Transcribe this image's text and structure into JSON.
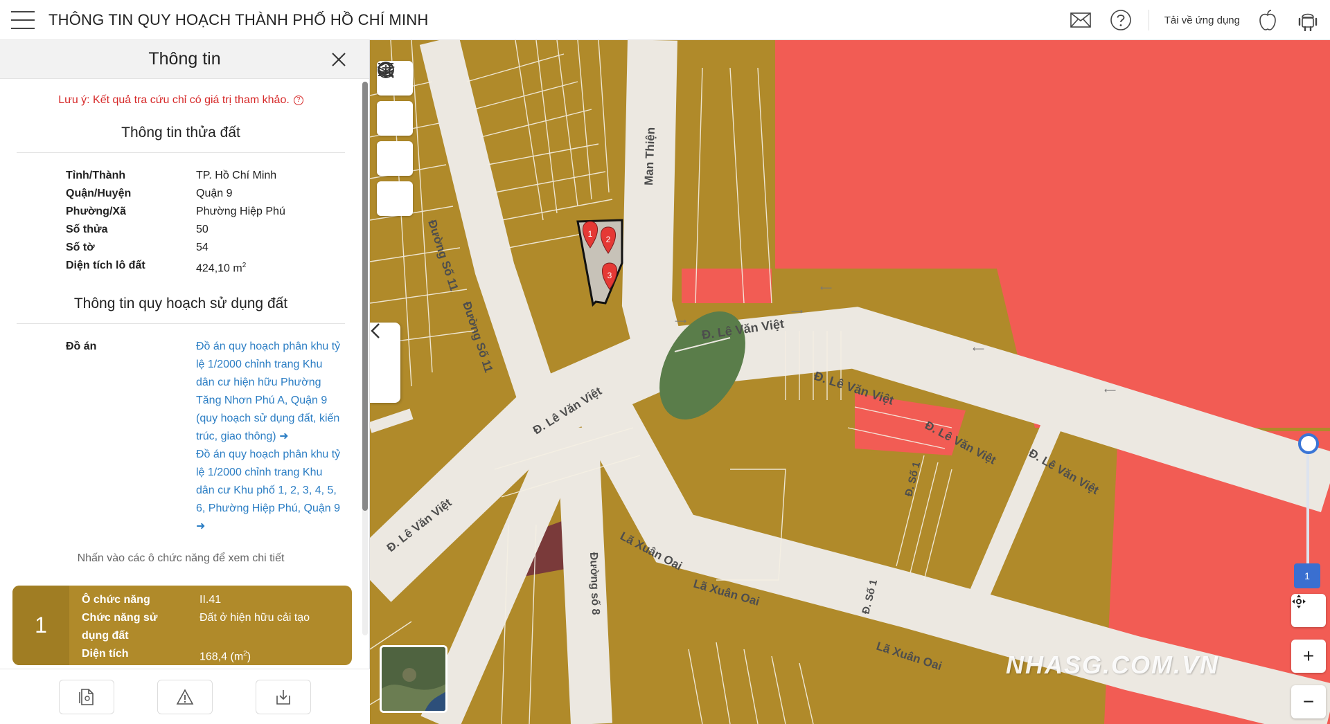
{
  "app": {
    "title": "THÔNG TIN QUY HOẠCH THÀNH PHỐ HỒ CHÍ MINH",
    "download_label": "Tải về ứng dụng",
    "icons": [
      "menu-icon",
      "mail-icon",
      "help-icon",
      "apple-icon",
      "android-icon"
    ]
  },
  "panel": {
    "title": "Thông tin",
    "note": "Lưu ý: Kết quả tra cứu chỉ có giá trị tham khảo.",
    "parcel_section": "Thông tin thửa đất",
    "parcel": [
      {
        "key": "Tỉnh/Thành",
        "value": "TP. Hồ Chí Minh"
      },
      {
        "key": "Quận/Huyện",
        "value": "Quận 9"
      },
      {
        "key": "Phường/Xã",
        "value": "Phường Hiệp Phú"
      },
      {
        "key": "Số thửa",
        "value": "50"
      },
      {
        "key": "Số tờ",
        "value": "54"
      }
    ],
    "area_key": "Diện tích lô đất",
    "area_value": "424,10 m",
    "area_unit_sup": "2",
    "plan_section": "Thông tin quy hoạch sử dụng đất",
    "plan_key": "Đồ án",
    "plans": [
      "Đồ án quy hoạch phân khu tỷ lệ 1/2000 chỉnh trang Khu dân cư hiện hữu Phường Tăng Nhơn Phú A, Quận 9 (quy hoạch sử dụng đất, kiến trúc, giao thông)",
      "Đồ án quy hoạch phân khu tỷ lệ 1/2000 chỉnh trang Khu dân cư Khu phố 1, 2, 3, 4, 5, 6, Phường Hiệp Phú, Quận 9"
    ],
    "hint": "Nhấn vào các ô chức năng để xem chi tiết",
    "zone": {
      "number": "1",
      "cell_key": "Ô chức năng",
      "cell_value": "II.41",
      "func_key": "Chức năng sử dụng đất",
      "func_value": "Đất ở hiện hữu cải tạo",
      "area_key": "Diện tích",
      "area_value": "168,4 (m",
      "area_sup": "2",
      "area_close": ")"
    },
    "footer_icons": [
      "document-icon",
      "warning-icon",
      "download-icon"
    ]
  },
  "map": {
    "roads": {
      "man_thien": "Man Thiện",
      "duong_so_11a": "Đường Số 11",
      "duong_so_11b": "Đường Số 11",
      "le_van_viet": "Đ. Lê Văn Việt",
      "la_xuan_oai": "Lã Xuân Oai",
      "duong_so_8": "Đường số 8",
      "duong_so_1": "Đ. Số 1",
      "d_prefix": "Đ."
    },
    "markers": [
      "1",
      "2",
      "3"
    ],
    "zoom_level_label": "1",
    "watermark": "NHASG.COM.VN",
    "colors": {
      "residential": "#b08a2a",
      "commercial": "#f25c54",
      "green": "#5a7d4a",
      "road": "#ece8e1",
      "other": "#7a3a3a"
    }
  }
}
